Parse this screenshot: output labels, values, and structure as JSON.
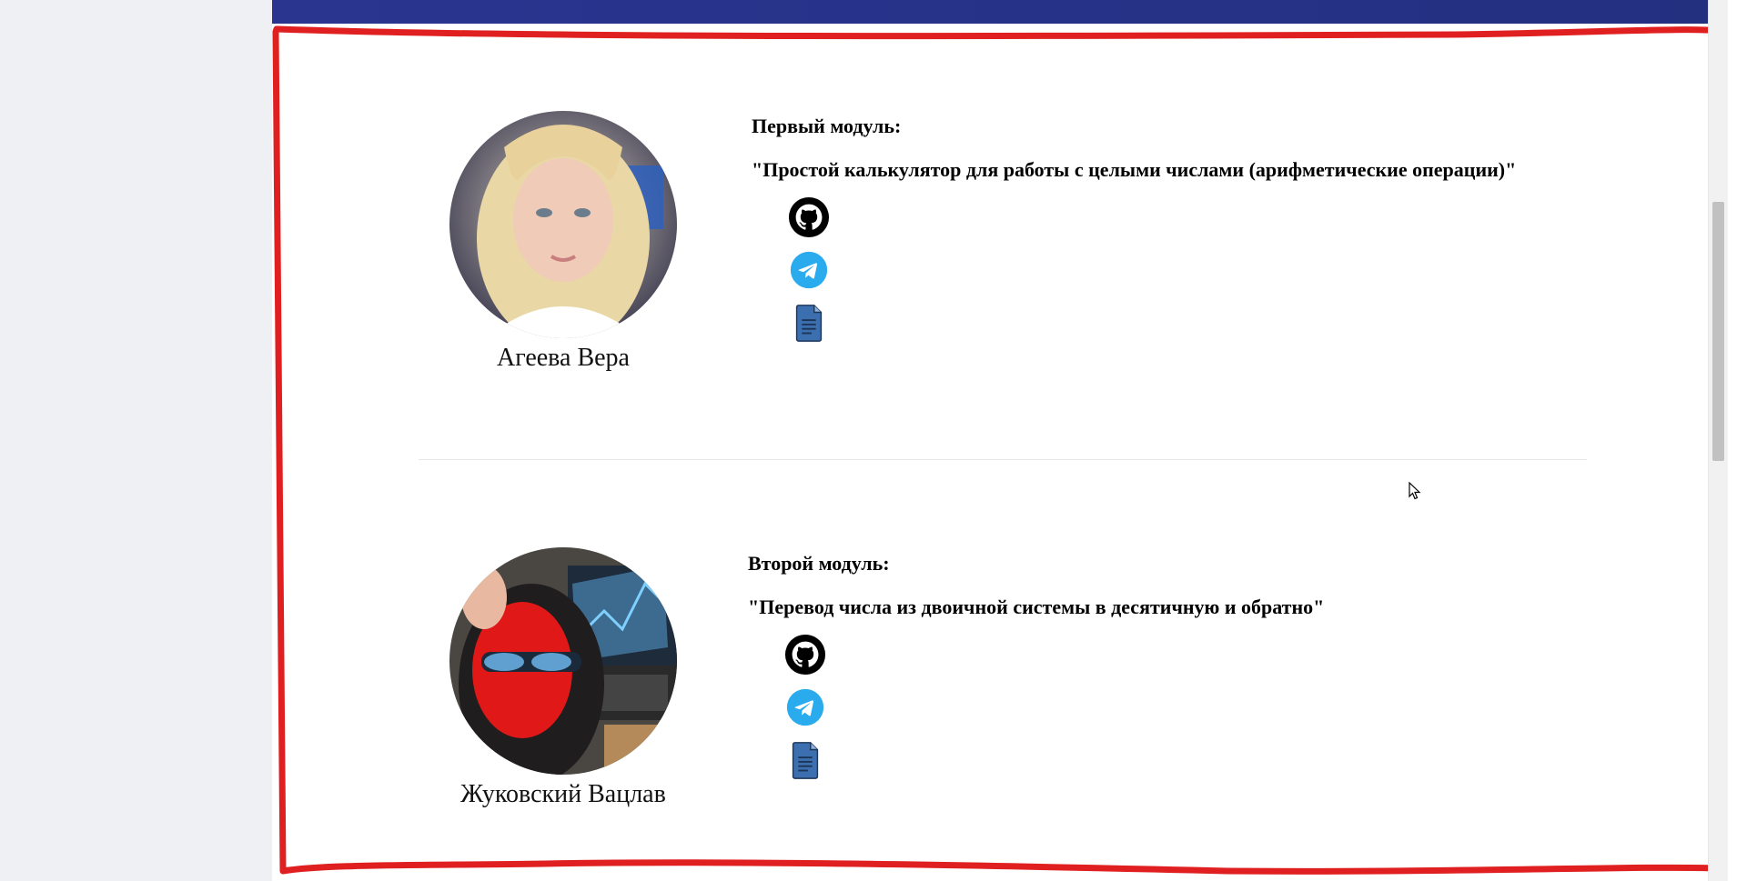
{
  "page": {
    "accent_bar_color": "#2a3590",
    "annotation_color": "#e02020"
  },
  "members": [
    {
      "module_label": "Первый модуль:",
      "module_title": "\"Простой калькулятор для работы с целыми числами (арифметические операции)\"",
      "name": "Агеева Вера",
      "links": [
        {
          "icon": "github-icon",
          "color": "#000000"
        },
        {
          "icon": "telegram-icon",
          "color": "#2AABEE"
        },
        {
          "icon": "document-icon",
          "color": "#3c6fb0"
        }
      ]
    },
    {
      "module_label": "Второй модуль:",
      "module_title": "\"Перевод числа из двоичной системы в десятичную и обратно\"",
      "name": "Жуковский Вацлав",
      "links": [
        {
          "icon": "github-icon",
          "color": "#000000"
        },
        {
          "icon": "telegram-icon",
          "color": "#2AABEE"
        },
        {
          "icon": "document-icon",
          "color": "#3c6fb0"
        }
      ]
    }
  ]
}
